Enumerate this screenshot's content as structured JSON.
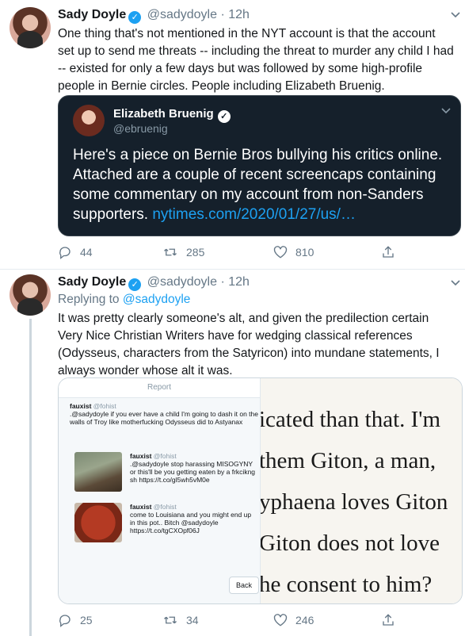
{
  "tweet1": {
    "name": "Sady Doyle",
    "handle": "@sadydoyle",
    "dot": "·",
    "time": "12h",
    "text": "One thing that's not mentioned in the NYT account is that the account set up to send me threats -- including the threat to murder any child I had -- existed for only a few days but was followed by some high-profile people in Bernie circles. People including Elizabeth Bruenig.",
    "quote": {
      "name": "Elizabeth Bruenig",
      "handle": "@ebruenig",
      "text": "Here's a piece on Bernie Bros bullying his critics online. Attached are a couple of recent screencaps containing some commentary on my account from non-Sanders supporters.",
      "link": "nytimes.com/2020/01/27/us/…"
    },
    "replies": "44",
    "retweets": "285",
    "likes": "810"
  },
  "tweet2": {
    "name": "Sady Doyle",
    "handle": "@sadydoyle",
    "dot": "·",
    "time": "12h",
    "replying_prefix": "Replying to",
    "replying_to": "@sadydoyle",
    "text": "It was pretty clearly someone's alt, and given the predilection certain Very Nice Christian Writers have for wedging classical references (Odysseus, characters from the Satyricon) into mundane statements, I always wonder whose alt it was.",
    "media": {
      "report_label": "Report",
      "posts": [
        {
          "name": "fauxist",
          "handle": "@fohist",
          "text": ".@sadydoyle if you ever have a child I'm going to dash it on the walls of Troy like motherfucking Odysseus did to Astyanax"
        },
        {
          "name": "fauxist",
          "handle": "@fohist",
          "text": ".@sadydoyle stop harassing MISOGYNY or this'll be you getting eaten by a frkcikng sh https://t.co/gl5wh5vM0e"
        },
        {
          "name": "fauxist",
          "handle": "@fohist",
          "text": "come to Louisiana and you might end up in this pot.. Bitch @sadydoyle https://t.co/tgCXOpf06J"
        }
      ],
      "back_label": "Back",
      "book_lines": [
        "icated than that. I'm",
        "them Giton, a man,",
        "yphaena loves Giton",
        "Giton does not love",
        "he consent to him?"
      ]
    },
    "replies": "25",
    "retweets": "34",
    "likes": "246"
  },
  "colors": {
    "accent": "#1da1f2",
    "muted": "#657786",
    "quote_bg": "#15202b"
  },
  "icons": [
    "verified-icon",
    "chevron-down-icon",
    "reply-icon",
    "retweet-icon",
    "like-icon",
    "share-icon"
  ]
}
